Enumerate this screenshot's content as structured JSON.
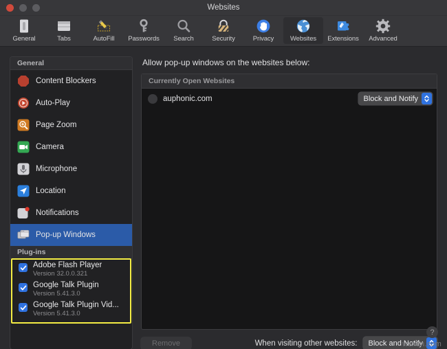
{
  "window": {
    "title": "Websites",
    "traffic_lights": [
      "close",
      "minimize",
      "zoom"
    ]
  },
  "toolbar": {
    "items": [
      {
        "label": "General",
        "icon": "general-icon",
        "active": false
      },
      {
        "label": "Tabs",
        "icon": "tabs-icon",
        "active": false
      },
      {
        "label": "AutoFill",
        "icon": "autofill-icon",
        "active": false
      },
      {
        "label": "Passwords",
        "icon": "passwords-icon",
        "active": false
      },
      {
        "label": "Search",
        "icon": "search-icon",
        "active": false
      },
      {
        "label": "Security",
        "icon": "security-icon",
        "active": false
      },
      {
        "label": "Privacy",
        "icon": "privacy-icon",
        "active": false
      },
      {
        "label": "Websites",
        "icon": "websites-icon",
        "active": true
      },
      {
        "label": "Extensions",
        "icon": "extensions-icon",
        "active": false
      },
      {
        "label": "Advanced",
        "icon": "advanced-icon",
        "active": false
      }
    ]
  },
  "sidebar": {
    "general_header": "General",
    "general_items": [
      {
        "label": "Content Blockers",
        "icon": "content-blockers-icon",
        "selected": false
      },
      {
        "label": "Auto-Play",
        "icon": "auto-play-icon",
        "selected": false
      },
      {
        "label": "Page Zoom",
        "icon": "page-zoom-icon",
        "selected": false
      },
      {
        "label": "Camera",
        "icon": "camera-icon",
        "selected": false
      },
      {
        "label": "Microphone",
        "icon": "microphone-icon",
        "selected": false
      },
      {
        "label": "Location",
        "icon": "location-icon",
        "selected": false
      },
      {
        "label": "Notifications",
        "icon": "notifications-icon",
        "selected": false
      },
      {
        "label": "Pop-up Windows",
        "icon": "popup-windows-icon",
        "selected": true
      }
    ],
    "plugins_header": "Plug-ins",
    "plugins": [
      {
        "name": "Adobe Flash Player",
        "version": "Version 32.0.0.321",
        "checked": true
      },
      {
        "name": "Google Talk Plugin",
        "version": "Version 5.41.3.0",
        "checked": true
      },
      {
        "name": "Google Talk Plugin Vid...",
        "version": "Version 5.41.3.0",
        "checked": true
      }
    ],
    "highlight_color": "#f5ee44"
  },
  "main": {
    "caption": "Allow pop-up windows on the websites below:",
    "list_header": "Currently Open Websites",
    "rows": [
      {
        "site": "auphonic.com",
        "setting": "Block and Notify",
        "favicon": "favicon-placeholder-icon"
      }
    ],
    "remove_label": "Remove",
    "remove_enabled": false,
    "other_websites_label": "When visiting other websites:",
    "other_websites_value": "Block and Notify"
  },
  "footer": {
    "help_label": "?",
    "watermark": "wsxdn.com"
  },
  "colors": {
    "accent_blue": "#2f72e0",
    "selection_blue": "#2b5ba8",
    "window_bg": "#2b2b2e",
    "sidebar_bg": "#212123",
    "list_bg": "#161617"
  }
}
